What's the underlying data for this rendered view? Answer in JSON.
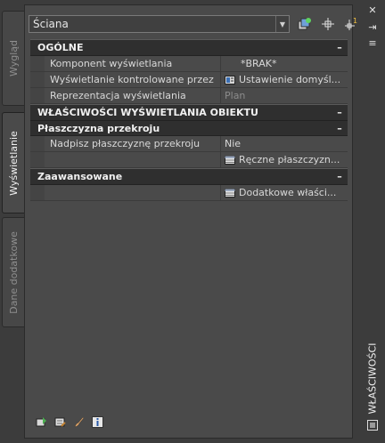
{
  "side_tabs": [
    {
      "label": "Wygląd",
      "active": false
    },
    {
      "label": "Wyświetlanie",
      "active": true
    },
    {
      "label": "Dane dodatkowe",
      "active": false
    }
  ],
  "top": {
    "selected_object": "Ściana",
    "buttons": [
      "quick-select-icon",
      "select-objects-icon",
      "toggle-pickadd-icon"
    ]
  },
  "sections": {
    "general": {
      "title": "OGÓLNE",
      "collapse": "–",
      "rows": [
        {
          "key": "Komponent wyświetlania",
          "value": "*BRAK*"
        },
        {
          "key": "Wyświetlanie kontrolowane przez",
          "value": "Ustawienie  domyśl..."
        },
        {
          "key": "Reprezentacja wyświetlania",
          "value": "Plan"
        }
      ]
    },
    "object_display": {
      "title": "WŁAŚCIWOŚCI WYŚWIETLANIA OBIEKTU",
      "collapse": "–",
      "subsection": {
        "title": "Płaszczyzna przekroju",
        "collapse": "–",
        "rows": [
          {
            "key": "Nadpisz płaszczyznę przekroju",
            "value": "Nie"
          },
          {
            "key": "",
            "value": "Ręczne  płaszczyzn..."
          }
        ]
      }
    },
    "advanced": {
      "title": "Zaawansowane",
      "collapse": "–",
      "rows": [
        {
          "key": "",
          "value": "Dodatkowe  właści..."
        }
      ]
    }
  },
  "palette_title": "WŁAŚCIWOŚCI",
  "window_buttons": {
    "close": "✕",
    "autohide": "⇥",
    "options": "≡"
  },
  "colors": {
    "background": "#3c3c3c",
    "panel": "#4a4a4a",
    "header": "#2f2f2f"
  }
}
